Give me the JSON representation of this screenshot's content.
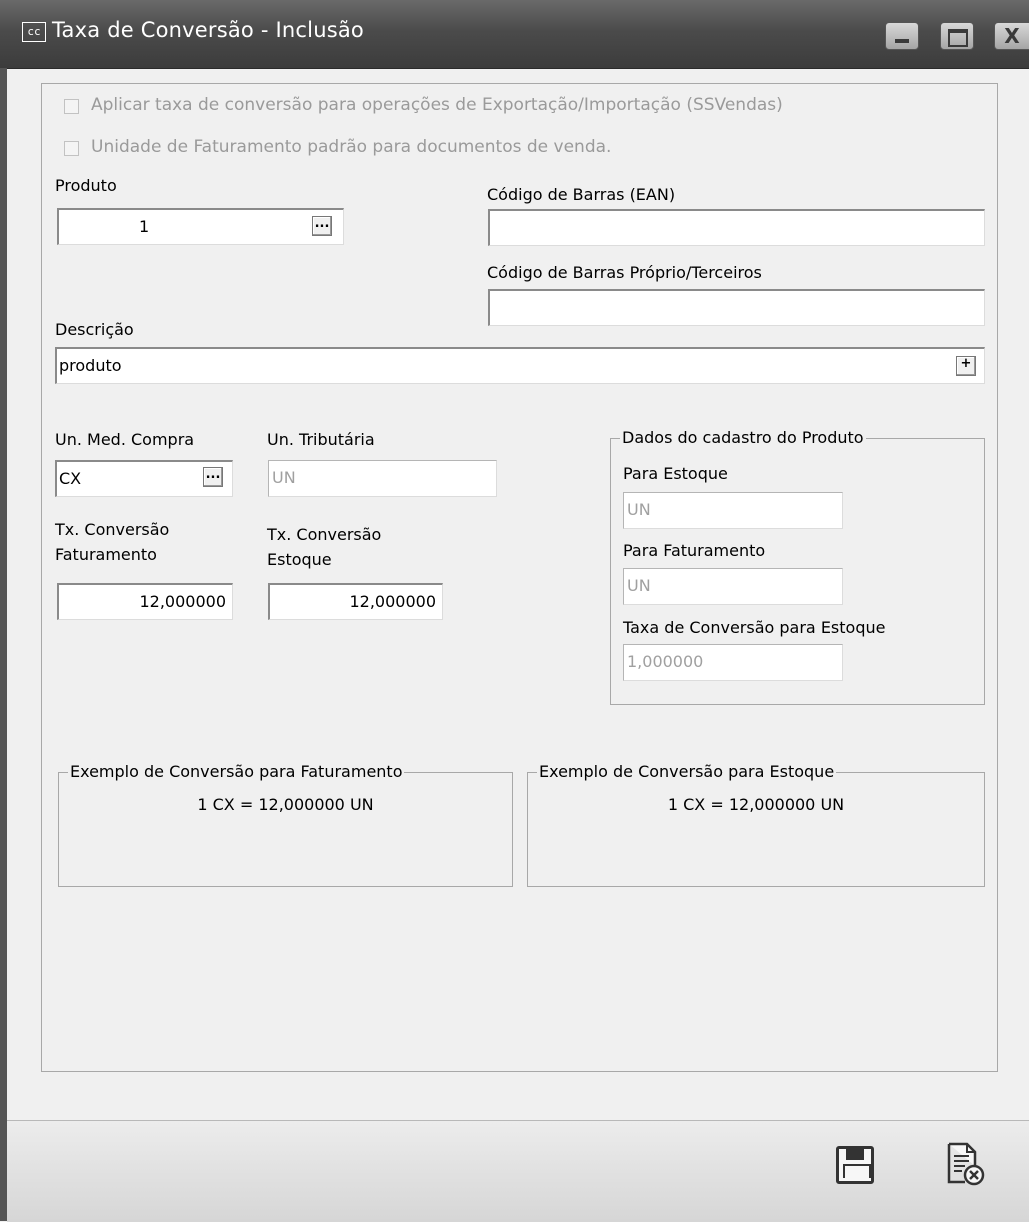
{
  "window": {
    "app_icon": "cc",
    "title": "Taxa de Conversão - Inclusão",
    "controls": {
      "minimize": "minimize-icon",
      "maximize": "maximize-icon",
      "close": "close-icon"
    }
  },
  "options": {
    "export_import_label": "Aplicar taxa de conversão para operações de Exportação/Importação (SSVendas)",
    "default_unit_label": "Unidade de Faturamento padrão para documentos de venda."
  },
  "produto": {
    "label": "Produto",
    "value": "1",
    "button": "..."
  },
  "ean": {
    "label": "Código de Barras (EAN)",
    "value": ""
  },
  "barcode_own": {
    "label": "Código de Barras Próprio/Terceiros",
    "value": ""
  },
  "descricao": {
    "label": "Descrição",
    "value": "produto",
    "button": "+"
  },
  "un_compra": {
    "label": "Un. Med. Compra",
    "value": "CX",
    "button": "..."
  },
  "un_tributaria": {
    "label": "Un. Tributária",
    "value": "UN"
  },
  "tx_faturamento": {
    "label_line1": "Tx. Conversão",
    "label_line2": "Faturamento",
    "value": "12,000000"
  },
  "tx_estoque": {
    "label_line1": "Tx. Conversão",
    "label_line2": "Estoque",
    "value": "12,000000"
  },
  "cadastro": {
    "legend": "Dados do cadastro do Produto",
    "estoque_label": "Para Estoque",
    "estoque_value": "UN",
    "faturamento_label": "Para Faturamento",
    "faturamento_value": "UN",
    "taxa_label": "Taxa de Conversão para Estoque",
    "taxa_value": "1,000000"
  },
  "exemplo_faturamento": {
    "legend": "Exemplo de Conversão para Faturamento",
    "text": "1 CX = 12,000000 UN"
  },
  "exemplo_estoque": {
    "legend": "Exemplo de Conversão para Estoque",
    "text": "1 CX = 12,000000 UN"
  },
  "toolbar": {
    "save_icon": "save-icon",
    "cancel_icon": "cancel-document-icon"
  }
}
